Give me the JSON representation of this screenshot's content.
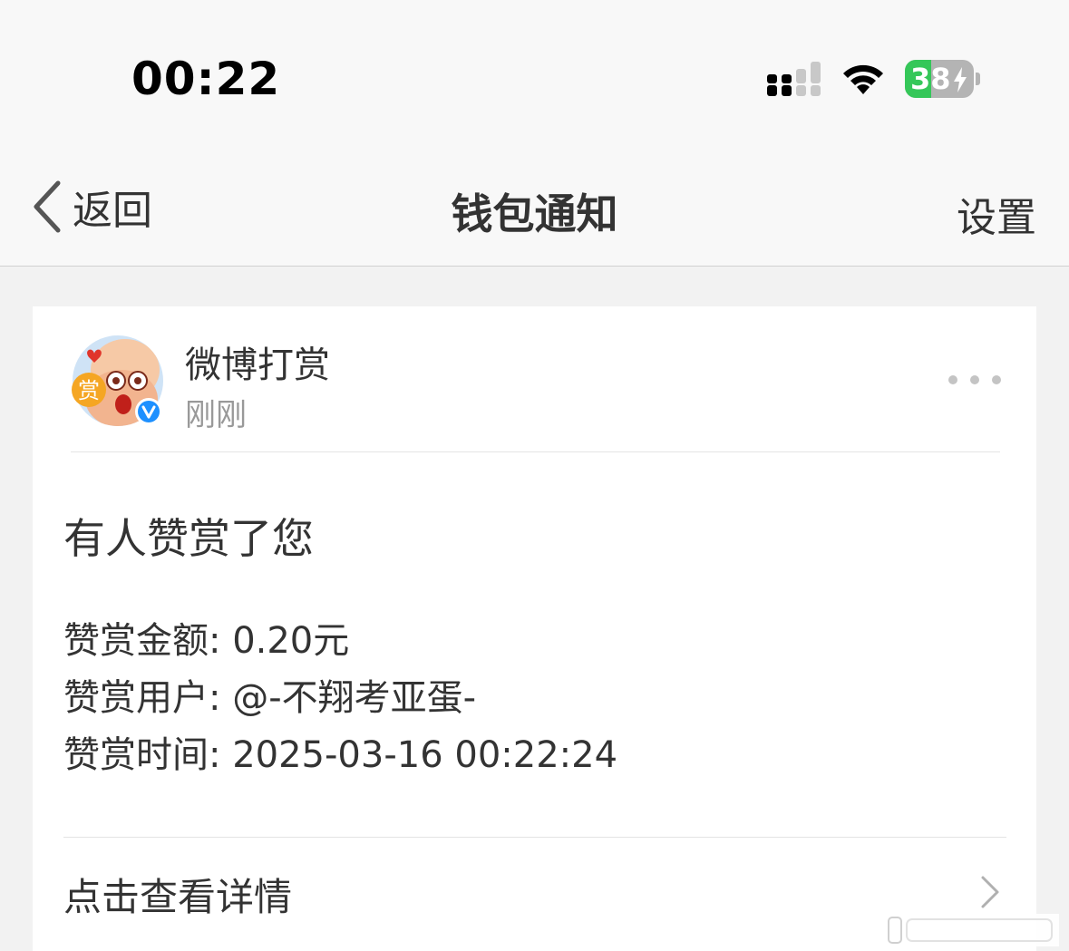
{
  "status_bar": {
    "time": "00:22",
    "battery_level": "38",
    "battery_fraction": 0.38,
    "signal_icon": "cellular-signal-icon",
    "wifi_icon": "wifi-icon",
    "battery_color": "#35c759"
  },
  "nav": {
    "back_label": "返回",
    "title": "钱包通知",
    "settings_label": "设置"
  },
  "card": {
    "sender_name": "微博打赏",
    "sender_time": "刚刚",
    "avatar_badge": "赏",
    "message_title": "有人赞赏了您",
    "details": [
      "赞赏金额: 0.20元",
      "赞赏用户: @-不翔考亚蛋-",
      "赞赏时间: 2025-03-16 00:22:24"
    ],
    "view_details_label": "点击查看详情"
  },
  "colors": {
    "verified_badge": "#1e90ff",
    "accent_orange": "#f5a623"
  }
}
